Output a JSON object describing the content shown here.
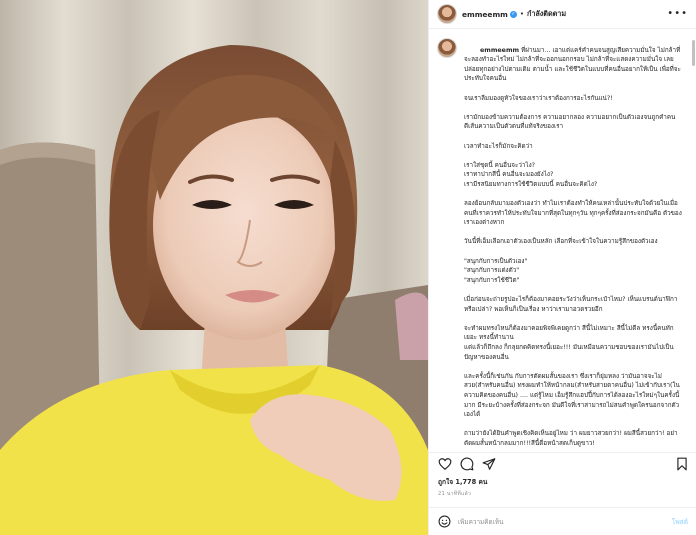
{
  "header": {
    "username": "emmeemm",
    "separator": "•",
    "follow_label": "กำลังติดตาม",
    "more_label": "•••"
  },
  "caption": {
    "username": "emmeemm",
    "paragraphs": [
      "ที่ผ่านมา... เอาแต่แคร์คำคนจนสูญเสียความมั่นใจ ไม่กล้าที่จะลองทำอะไรใหม่ ไม่กล้าที่จะออกนอกกรอบ ไม่กล้าที่จะแสดงความมั่นใจ เลยปล่อยทุกอย่างไปตามเดิม ตามน้ำ และใช้ชีวิตในแบบที่คนอื่นอยากให้เป็น เพื่อที่จะประทับใจคนอื่น",
      "จนเราลืมมองดูหัวใจของเราว่าเราต้องการอะไรกันแน่?!",
      "เรามักมองข้ามความต้องการ ความอยากลอง ความอยากเป็นตัวเองจนถูกคำคนตีเส้นความเป็นตัวตนที่แท้จริงของเรา",
      "เวลาทำอะไรก็มักจะคิดว่า",
      "เราใส่ชุดนี้ คนอื่นจะว่าไง?\nเราทาปากสีนี้ คนอื่นจะมองยังไง?\nเรามีรสนิยมทางการใช้ชีวิตแบบนี้ คนอื่นจะคิดไง?",
      "ลองย้อนกลับมามองตัวเองว่า ทำไมเราต้องทำให้คนเหล่านั้นประทับใจด้วยในเมื่อคนที่เราควรทำให้ประทับใจมากที่สุดในทุกๆวัน ทุกๆครั้งที่ส่องกระจกมันคือ ตัวของเราเองต่างหาก",
      "วันนี้ที่เอ็มเลือกเอาตัวเองเป็นหลัก เลือกที่จะเข้าใจในความรู้สึกของตัวเอง",
      "\"สนุกกับการเป็นตัวเอง\"\n\"สนุกกับการแต่งตัว\"\n\"สนุกกับการใช้ชีวิต\"",
      "เมื่อก่อนจะถ่ายรูปอะไรก็ต้องมาคอยระวังว่าเห็นกระเป๋าไหม? เห็นแบรนด์นาฬิกาหรือเปล่า? พอเห็นก็เป็นเรื่อง หาว่าเรามาอวดรวยอีก",
      "จะทำผมทรงไหนก็ต้องมาคอยพิจพิเคยดูกว่า สีนี้ไม่เหมาะ สีนี้ไม่ดีล ทรงนี้คนทักเยอะ ทรงนี้ทำนาน\nแต่แล้วก็ถึกลง ก็กลุยกดคิดทรงนี้เยอะ!!! มันเหมือนความชอบของเรามันไปเป็นปัญหาของคนอื่น",
      "และครั้งนี้ก็เช่นกัน กับการตัดผมสั้นของเรา ซึ่งเราก็ยุ่มหลง ว่ามันอาจจะไม่สวย(สำหรับคนอื่น) ทรงผมทำให้หน้ากลม(สำหรับสายตาคนอื่น) ไม่เข้ากับเรา(ในความคิดของคนอื่น) .... แต่รู้ไหม เอ็มรู้สึกแฮปปี้กับการได้ลองอะไรใหม่ๆในครั้งนี้มาก มีระยะบ้างครั้งที่ส่องกระจก มันดีใจที่เราสามารถไม่สนคำพูดใครนอกจากตัวเองได้",
      "ถามว่ายังได้ยินคำพูดเชิงคิดเห็นอยู่ไหม ว่า ผมยาวสวยกว่า! ผมสีนี้สวยกว่า! อย่าตัดผมสั้นหน้ากลมมาก!!!สีนี้ดื่อหน้าสดเก็บดูขาว!"
    ]
  },
  "actions": {
    "like_icon": "heart-icon",
    "comment_icon": "comment-icon",
    "share_icon": "share-icon",
    "save_icon": "bookmark-icon"
  },
  "likes_text": "ถูกใจ 1,778 คน",
  "timestamp": "21 นาทีที่แล้ว",
  "comment": {
    "placeholder": "เพิ่มความคิดเห็น",
    "post_label": "โพสต์"
  },
  "colors": {
    "verified": "#3897f0",
    "post_button": "#b2dffc",
    "shirt": "#f2e24a",
    "sofa": "#9c8a78",
    "curtain": "#d8d2c6"
  }
}
